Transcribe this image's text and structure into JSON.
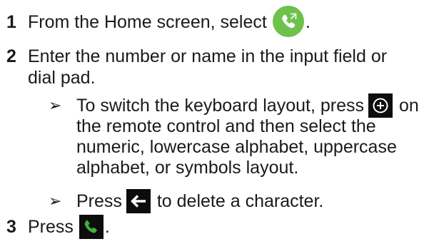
{
  "steps": [
    {
      "num": "1",
      "text_before": "From the Home screen, select",
      "text_after": "."
    },
    {
      "num": "2",
      "line1": "Enter the number or name in the input field or",
      "line2": "dial pad."
    },
    {
      "num": "3",
      "text_before": "Press",
      "text_after": "."
    }
  ],
  "bullets": [
    {
      "arrow": "➢",
      "line1_before": "To switch the keyboard layout, press",
      "line1_after": "on",
      "line2": "the remote control and then select the",
      "line3": "numeric, lowercase alphabet, uppercase",
      "line4": "alphabet, or symbols layout."
    },
    {
      "arrow": "➢",
      "text_before": "Press",
      "text_after": "to delete a character."
    }
  ],
  "icons": {
    "call_app": "phone-call-app-icon",
    "plus_button": "plus-circle-icon",
    "back_button": "arrow-left-icon",
    "call_button": "phone-icon"
  },
  "colors": {
    "call_app_green": "#6cc24a",
    "phone_green": "#3fb33a",
    "icon_dark": "#0d0d0d"
  }
}
